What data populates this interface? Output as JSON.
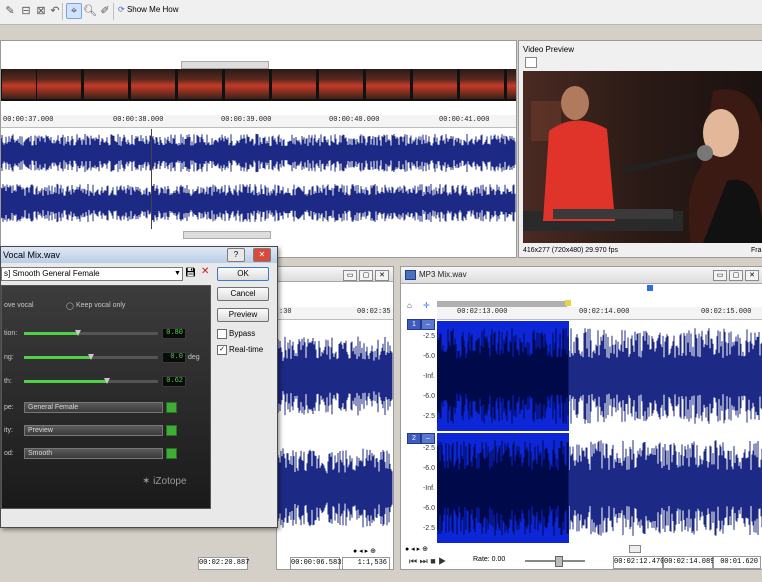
{
  "toolbar": {
    "show_me_how": "Show Me How"
  },
  "timeline": {
    "ruler_labels": [
      "00:00:37.000",
      "00:00:38.000",
      "00:00:39.000",
      "00:00:40.000",
      "00:00:41.000"
    ]
  },
  "video_preview": {
    "title": "Video Preview",
    "info": "416x277 (720x480) 29.970 fps",
    "info_right": "Fra"
  },
  "dialog": {
    "title": "Vocal Mix.wav",
    "preset": "s] Smooth General Female",
    "remove_vocal": "ove vocal",
    "keep_vocal": "Keep vocal only",
    "ok": "OK",
    "cancel": "Cancel",
    "preview": "Preview",
    "bypass": "Bypass",
    "realtime": "Real-time",
    "sliders": [
      {
        "label": "tion:",
        "value": "0.80",
        "unit": "",
        "level": 0.4
      },
      {
        "label": "ng:",
        "value": "0.0",
        "unit": "deg",
        "level": 0.5
      },
      {
        "label": "th:",
        "value": "0.62",
        "unit": "",
        "level": 0.62
      }
    ],
    "combos": [
      {
        "label": "pe:",
        "value": "General Female"
      },
      {
        "label": "ity:",
        "value": "Preview"
      },
      {
        "label": "od:",
        "value": "Smooth"
      }
    ],
    "brand": "iZotope"
  },
  "middle_pane": {
    "ruler_labels": [
      ":30",
      "00:02:35"
    ],
    "status_left": "00:02:20.887",
    "status_mid": "00:00:06.583",
    "status_right": "1:1,536"
  },
  "mp3_pane": {
    "title": "MP3 Mix.wav",
    "ruler_labels": [
      "00:02:13.000",
      "00:02:14.000",
      "00:02:15.000"
    ],
    "track_labels": [
      "1",
      "2"
    ],
    "db_scale": [
      "-2.5",
      "-6.0",
      "-Inf.",
      "-6.0",
      "-2.5"
    ],
    "rate_label": "Rate: 0.00",
    "status_a": "00:02:12.470",
    "status_b": "00:02:14.089",
    "status_c": "00:01.620"
  },
  "colors": {
    "waveform": "#1c2a86",
    "selection": "#0d26d8",
    "accent_green": "#52d048"
  }
}
